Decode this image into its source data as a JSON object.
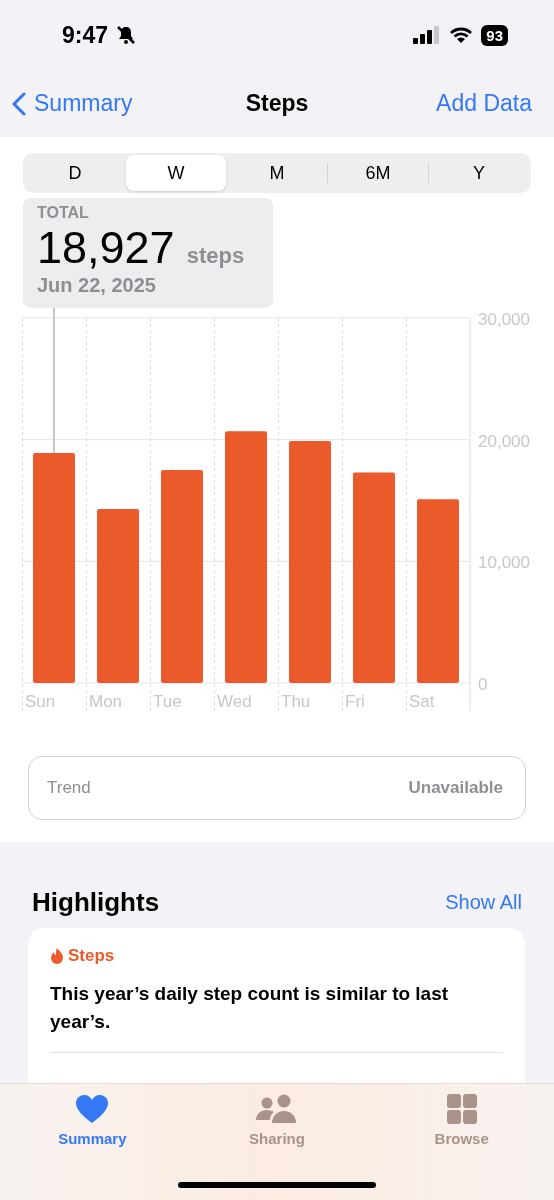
{
  "status_bar": {
    "time": "9:47",
    "battery": "93"
  },
  "nav": {
    "back": "Summary",
    "title": "Steps",
    "action": "Add Data"
  },
  "range_tabs": [
    {
      "label": "D",
      "selected": false
    },
    {
      "label": "W",
      "selected": true
    },
    {
      "label": "M",
      "selected": false
    },
    {
      "label": "6M",
      "selected": false
    },
    {
      "label": "Y",
      "selected": false
    }
  ],
  "total": {
    "label": "TOTAL",
    "value": "18,927",
    "unit": "steps",
    "date": "Jun 22, 2025"
  },
  "chart_data": {
    "type": "bar",
    "categories": [
      "Sun",
      "Mon",
      "Tue",
      "Wed",
      "Thu",
      "Fri",
      "Sat"
    ],
    "series": [
      {
        "color": "#eb5a2a",
        "values": [
          18900,
          14300,
          17500,
          20700,
          19900,
          17300,
          15100
        ]
      }
    ],
    "ylim": [
      0,
      30000
    ],
    "yticks": [
      {
        "value": 0,
        "label": "0"
      },
      {
        "value": 10000,
        "label": "10,000"
      },
      {
        "value": 20000,
        "label": "20,000"
      },
      {
        "value": 30000,
        "label": "30,000"
      }
    ]
  },
  "trend": {
    "label": "Trend",
    "value": "Unavailable"
  },
  "highlights": {
    "title": "Highlights",
    "action": "Show All",
    "cards": [
      {
        "category": "Steps",
        "text": "This year’s daily step count is similar to last year’s."
      }
    ]
  },
  "tab_bar": [
    {
      "kind": "heart",
      "label": "Summary",
      "selected": true
    },
    {
      "kind": "people",
      "label": "Sharing",
      "selected": false
    },
    {
      "kind": "grid",
      "label": "Browse",
      "selected": false
    }
  ]
}
